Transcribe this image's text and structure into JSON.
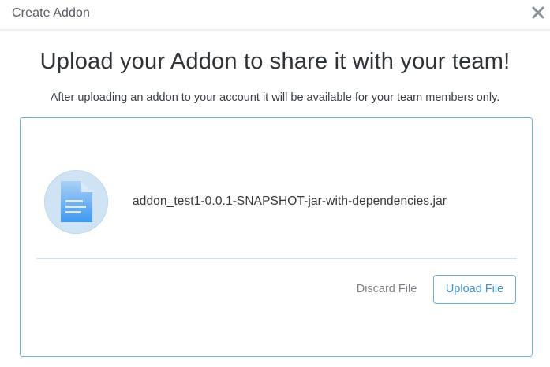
{
  "dialog": {
    "title": "Create Addon",
    "close_icon": "close-icon"
  },
  "main": {
    "headline": "Upload your Addon to share it with your team!",
    "description": "After uploading an addon to your account it will be available for your team members only."
  },
  "upload": {
    "file_icon": "document-file-icon",
    "file_name": "addon_test1-0.0.1-SNAPSHOT-jar-with-dependencies.jar",
    "discard_label": "Discard File",
    "upload_label": "Upload File"
  },
  "colors": {
    "accent": "#3d8fcf",
    "border": "#69b2e1",
    "icon_bg": "#cfe3f4"
  }
}
